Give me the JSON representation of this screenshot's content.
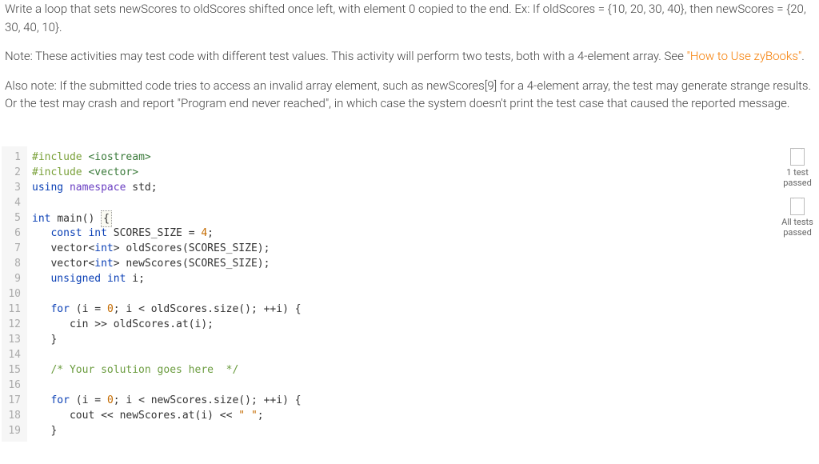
{
  "instructions": {
    "p1": "Write a loop that sets newScores to oldScores shifted once left, with element 0 copied to the end. Ex: If oldScores = {10, 20, 30, 40}, then newScores = {20, 30, 40, 10}.",
    "p2_a": "Note: These activities may test code with different test values. This activity will perform two tests, both with a 4-element array. See ",
    "p2_link": "\"How to Use zyBooks\"",
    "p2_b": ".",
    "p3": "Also note: If the submitted code tries to access an invalid array element, such as newScores[9] for a 4-element array, the test may generate strange results. Or the test may crash and report \"Program end never reached\", in which case the system doesn't print the test case that caused the reported message."
  },
  "code": {
    "tokens": [
      [
        [
          "pp",
          "#include "
        ],
        [
          "ang",
          "<iostream>"
        ]
      ],
      [
        [
          "pp",
          "#include "
        ],
        [
          "ang",
          "<vector>"
        ]
      ],
      [
        [
          "kw",
          "using "
        ],
        [
          "ns",
          "namespace "
        ],
        [
          "id",
          "std"
        ],
        [
          "op",
          ";"
        ]
      ],
      [],
      [
        [
          "ty",
          "int "
        ],
        [
          "id",
          "main() "
        ],
        [
          "boxed",
          "{"
        ]
      ],
      [
        [
          "sp",
          "   "
        ],
        [
          "kw",
          "const "
        ],
        [
          "ty",
          "int "
        ],
        [
          "id",
          "SCORES_SIZE "
        ],
        [
          "op",
          "= "
        ],
        [
          "num",
          "4"
        ],
        [
          "op",
          ";"
        ]
      ],
      [
        [
          "sp",
          "   "
        ],
        [
          "id",
          "vector"
        ],
        [
          "op",
          "<"
        ],
        [
          "ty",
          "int"
        ],
        [
          "op",
          "> "
        ],
        [
          "id",
          "oldScores(SCORES_SIZE)"
        ],
        [
          "op",
          ";"
        ]
      ],
      [
        [
          "sp",
          "   "
        ],
        [
          "id",
          "vector"
        ],
        [
          "op",
          "<"
        ],
        [
          "ty",
          "int"
        ],
        [
          "op",
          "> "
        ],
        [
          "id",
          "newScores(SCORES_SIZE)"
        ],
        [
          "op",
          ";"
        ]
      ],
      [
        [
          "sp",
          "   "
        ],
        [
          "kw",
          "unsigned "
        ],
        [
          "ty",
          "int "
        ],
        [
          "id",
          "i"
        ],
        [
          "op",
          ";"
        ]
      ],
      [],
      [
        [
          "sp",
          "   "
        ],
        [
          "kw",
          "for "
        ],
        [
          "op",
          "(i = "
        ],
        [
          "num",
          "0"
        ],
        [
          "op",
          "; i < oldScores.size(); ++i) {"
        ]
      ],
      [
        [
          "sp",
          "      "
        ],
        [
          "id",
          "cin >> oldScores.at(i)"
        ],
        [
          "op",
          ";"
        ]
      ],
      [
        [
          "sp",
          "   "
        ],
        [
          "op",
          "}"
        ]
      ],
      [],
      [
        [
          "sp",
          "   "
        ],
        [
          "cm",
          "/* Your solution goes here  */"
        ]
      ],
      [],
      [
        [
          "sp",
          "   "
        ],
        [
          "kw",
          "for "
        ],
        [
          "op",
          "(i = "
        ],
        [
          "num",
          "0"
        ],
        [
          "op",
          "; i < newScores.size(); ++i) {"
        ]
      ],
      [
        [
          "sp",
          "      "
        ],
        [
          "id",
          "cout << newScores.at(i) << "
        ],
        [
          "str",
          "\" \""
        ],
        [
          "op",
          ";"
        ]
      ],
      [
        [
          "sp",
          "   "
        ],
        [
          "op",
          "}"
        ]
      ]
    ],
    "line_start": 1
  },
  "status": {
    "items": [
      {
        "label_a": "1 test",
        "label_b": "passed"
      },
      {
        "label_a": "All tests",
        "label_b": "passed"
      }
    ]
  }
}
